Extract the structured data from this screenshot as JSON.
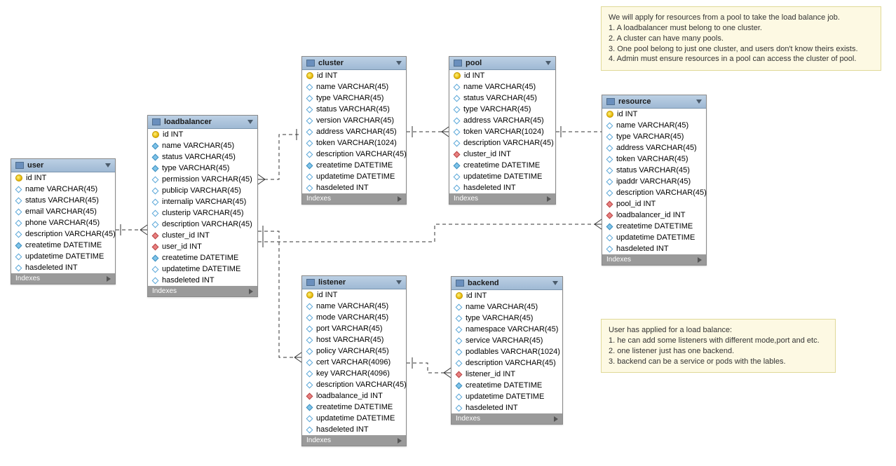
{
  "notes": {
    "top": {
      "lines": [
        "We will apply  for resources from a pool to take the load balance job.",
        "1. A loadbalancer must belong to one cluster.",
        "2. A cluster can have many pools.",
        "3. One pool belong to just one cluster,  and users don't know theirs exists.",
        "4. Admin must ensure resources in a pool can access the cluster of pool."
      ]
    },
    "bottom": {
      "lines": [
        "User has applied for a load balance:",
        "1. he can add some listeners with different mode,port and etc.",
        "2. one listener just has one backend.",
        "3. backend can be a service or pods with the lables."
      ]
    }
  },
  "tables": {
    "user": {
      "title": "user",
      "columns": [
        {
          "icon": "pk",
          "label": "id INT"
        },
        {
          "icon": "regular",
          "label": "name VARCHAR(45)"
        },
        {
          "icon": "regular",
          "label": "status VARCHAR(45)"
        },
        {
          "icon": "regular",
          "label": "email VARCHAR(45)"
        },
        {
          "icon": "regular",
          "label": "phone VARCHAR(45)"
        },
        {
          "icon": "regular",
          "label": "description VARCHAR(45)"
        },
        {
          "icon": "filled",
          "label": "createtime DATETIME"
        },
        {
          "icon": "regular",
          "label": "updatetime DATETIME"
        },
        {
          "icon": "regular",
          "label": "hasdeleted INT"
        }
      ],
      "indexes": "Indexes"
    },
    "loadbalancer": {
      "title": "loadbalancer",
      "columns": [
        {
          "icon": "pk",
          "label": "id INT"
        },
        {
          "icon": "filled",
          "label": "name VARCHAR(45)"
        },
        {
          "icon": "filled",
          "label": "status VARCHAR(45)"
        },
        {
          "icon": "filled",
          "label": "type VARCHAR(45)"
        },
        {
          "icon": "regular",
          "label": "permission VARCHAR(45)"
        },
        {
          "icon": "regular",
          "label": "publicip VARCHAR(45)"
        },
        {
          "icon": "regular",
          "label": "internalip VARCHAR(45)"
        },
        {
          "icon": "regular",
          "label": "clusterip VARCHAR(45)"
        },
        {
          "icon": "regular",
          "label": "description VARCHAR(45)"
        },
        {
          "icon": "fk",
          "label": "cluster_id INT"
        },
        {
          "icon": "fk",
          "label": "user_id INT"
        },
        {
          "icon": "filled",
          "label": "createtime DATETIME"
        },
        {
          "icon": "regular",
          "label": "updatetime DATETIME"
        },
        {
          "icon": "regular",
          "label": "hasdeleted INT"
        }
      ],
      "indexes": "Indexes"
    },
    "cluster": {
      "title": "cluster",
      "columns": [
        {
          "icon": "pk",
          "label": "id INT"
        },
        {
          "icon": "regular",
          "label": "name VARCHAR(45)"
        },
        {
          "icon": "regular",
          "label": "type VARCHAR(45)"
        },
        {
          "icon": "regular",
          "label": "status VARCHAR(45)"
        },
        {
          "icon": "regular",
          "label": "version VARCHAR(45)"
        },
        {
          "icon": "regular",
          "label": "address VARCHAR(45)"
        },
        {
          "icon": "regular",
          "label": "token VARCHAR(1024)"
        },
        {
          "icon": "regular",
          "label": "description VARCHAR(45)"
        },
        {
          "icon": "filled",
          "label": "createtime DATETIME"
        },
        {
          "icon": "regular",
          "label": "updatetime DATETIME"
        },
        {
          "icon": "regular",
          "label": "hasdeleted INT"
        }
      ],
      "indexes": "Indexes"
    },
    "pool": {
      "title": "pool",
      "columns": [
        {
          "icon": "pk",
          "label": "id INT"
        },
        {
          "icon": "regular",
          "label": "name VARCHAR(45)"
        },
        {
          "icon": "regular",
          "label": "status VARCHAR(45)"
        },
        {
          "icon": "regular",
          "label": "type VARCHAR(45)"
        },
        {
          "icon": "regular",
          "label": "address VARCHAR(45)"
        },
        {
          "icon": "regular",
          "label": "token VARCHAR(1024)"
        },
        {
          "icon": "regular",
          "label": "description VARCHAR(45)"
        },
        {
          "icon": "fk",
          "label": "cluster_id INT"
        },
        {
          "icon": "filled",
          "label": "createtime DATETIME"
        },
        {
          "icon": "regular",
          "label": "updatetime DATETIME"
        },
        {
          "icon": "regular",
          "label": "hasdeleted INT"
        }
      ],
      "indexes": "Indexes"
    },
    "resource": {
      "title": "resource",
      "columns": [
        {
          "icon": "pk",
          "label": "id INT"
        },
        {
          "icon": "regular",
          "label": "name VARCHAR(45)"
        },
        {
          "icon": "regular",
          "label": "type VARCHAR(45)"
        },
        {
          "icon": "regular",
          "label": "address VARCHAR(45)"
        },
        {
          "icon": "regular",
          "label": "token VARCHAR(45)"
        },
        {
          "icon": "regular",
          "label": "status VARCHAR(45)"
        },
        {
          "icon": "regular",
          "label": "ipaddr VARCHAR(45)"
        },
        {
          "icon": "regular",
          "label": "description VARCHAR(45)"
        },
        {
          "icon": "fk",
          "label": "pool_id INT"
        },
        {
          "icon": "fk",
          "label": "loadbalancer_id INT"
        },
        {
          "icon": "filled",
          "label": "createtime DATETIME"
        },
        {
          "icon": "regular",
          "label": "updatetime DATETIME"
        },
        {
          "icon": "regular",
          "label": "hasdeleted INT"
        }
      ],
      "indexes": "Indexes"
    },
    "listener": {
      "title": "listener",
      "columns": [
        {
          "icon": "pk",
          "label": "id INT"
        },
        {
          "icon": "regular",
          "label": "name VARCHAR(45)"
        },
        {
          "icon": "regular",
          "label": "mode VARCHAR(45)"
        },
        {
          "icon": "regular",
          "label": "port VARCHAR(45)"
        },
        {
          "icon": "regular",
          "label": "host VARCHAR(45)"
        },
        {
          "icon": "regular",
          "label": "policy VARCHAR(45)"
        },
        {
          "icon": "regular",
          "label": "cert VARCHAR(4096)"
        },
        {
          "icon": "regular",
          "label": "key VARCHAR(4096)"
        },
        {
          "icon": "regular",
          "label": "description VARCHAR(45)"
        },
        {
          "icon": "fk",
          "label": "loadbalance_id INT"
        },
        {
          "icon": "filled",
          "label": "createtime DATETIME"
        },
        {
          "icon": "regular",
          "label": "updatetime DATETIME"
        },
        {
          "icon": "regular",
          "label": "hasdeleted INT"
        }
      ],
      "indexes": "Indexes"
    },
    "backend": {
      "title": "backend",
      "columns": [
        {
          "icon": "pk",
          "label": "id INT"
        },
        {
          "icon": "regular",
          "label": "name VARCHAR(45)"
        },
        {
          "icon": "regular",
          "label": "type VARCHAR(45)"
        },
        {
          "icon": "regular",
          "label": "namespace VARCHAR(45)"
        },
        {
          "icon": "regular",
          "label": "service VARCHAR(45)"
        },
        {
          "icon": "regular",
          "label": "podlables VARCHAR(1024)"
        },
        {
          "icon": "regular",
          "label": "description VARCHAR(45)"
        },
        {
          "icon": "fk",
          "label": "listener_id INT"
        },
        {
          "icon": "filled",
          "label": "createtime DATETIME"
        },
        {
          "icon": "regular",
          "label": "updatetime DATETIME"
        },
        {
          "icon": "regular",
          "label": "hasdeleted INT"
        }
      ],
      "indexes": "Indexes"
    }
  }
}
